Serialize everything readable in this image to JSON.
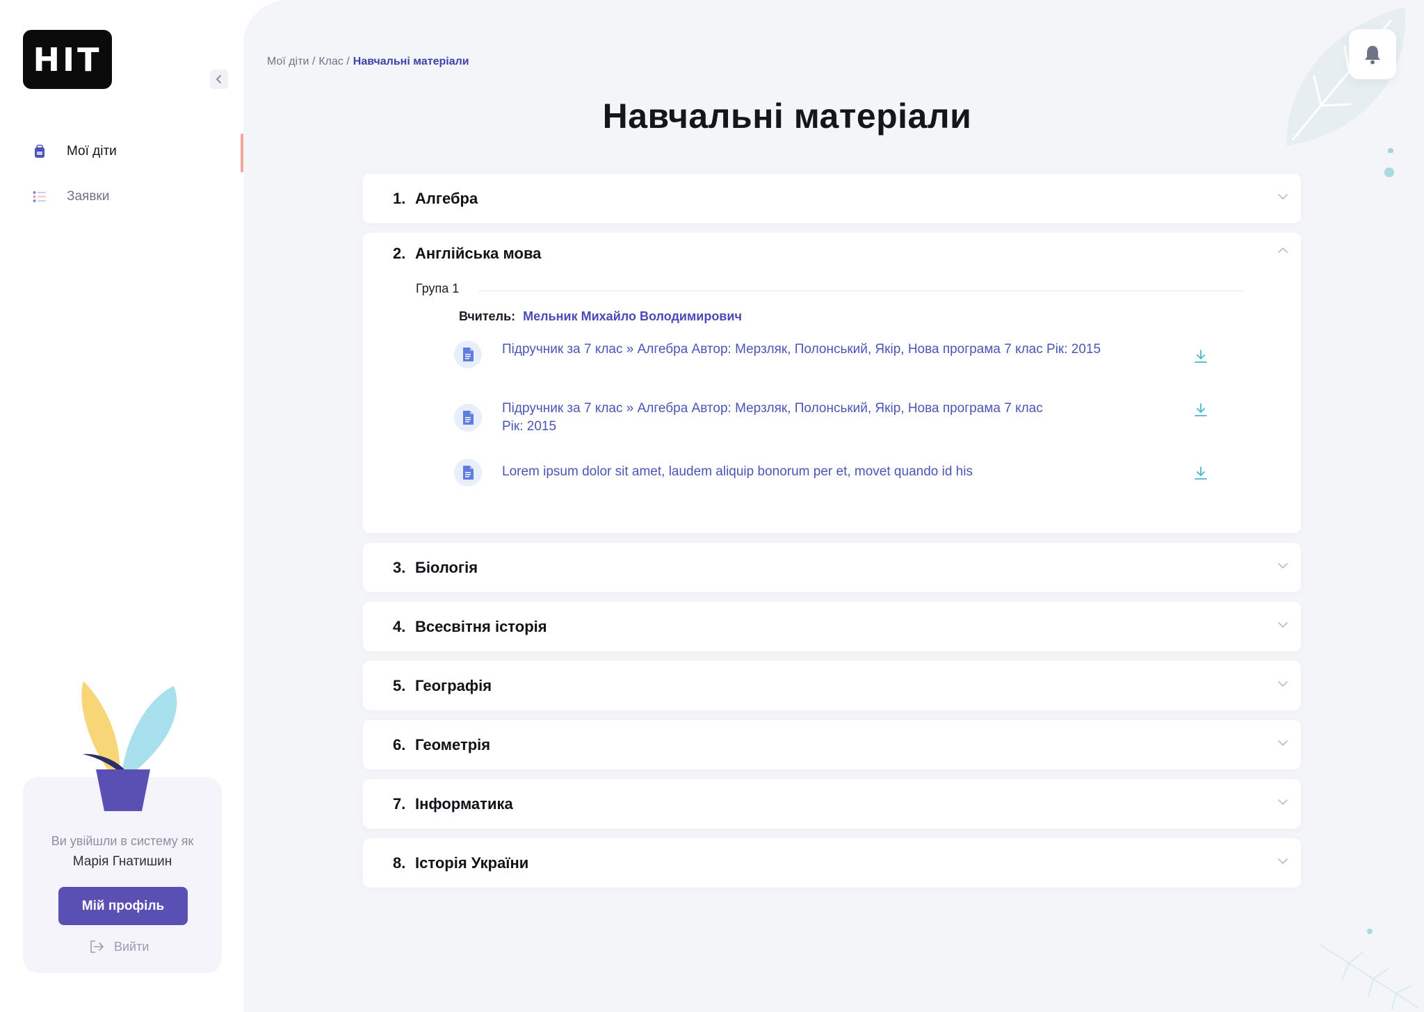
{
  "logo_text": "НІТ",
  "sidebar": {
    "items": [
      {
        "label": "Мої діти",
        "icon": "backpack-icon",
        "active": true
      },
      {
        "label": "Заявки",
        "icon": "list-icon",
        "active": false
      }
    ],
    "logged_in_as": "Ви увійшли в систему як",
    "user_name": "Марія Гнатишин",
    "profile_button": "Мій профіль",
    "logout": "Вийти"
  },
  "breadcrumb": [
    {
      "label": "Мої діти /"
    },
    {
      "label": "Клас /"
    },
    {
      "label": "Навчальні матеріали"
    }
  ],
  "page_title": "Навчальні матеріали",
  "subjects": [
    {
      "num": "1.",
      "name": "Алгебра",
      "open": false
    },
    {
      "num": "2.",
      "name": "Англійська мова",
      "open": true,
      "group": "Група 1",
      "teacher_label": "Вчитель:",
      "teacher_name": "Мельник Михайло Володимирович",
      "materials": [
        {
          "title": "Підручник за 7 клас » Алгебра Автор: Мерзляк, Полонський, Якір, Нова програма 7 клас Рік: 2015"
        },
        {
          "title": "Підручник за 7 клас » Алгебра Автор: Мерзляк, Полонський, Якір, Нова програма 7 клас Рік: 2015"
        },
        {
          "title": "Lorem ipsum dolor sit amet, laudem aliquip bonorum per et, movet quando id his"
        }
      ]
    },
    {
      "num": "3.",
      "name": "Біологія",
      "open": false
    },
    {
      "num": "4.",
      "name": "Всесвітня історія",
      "open": false
    },
    {
      "num": "5.",
      "name": "Географія",
      "open": false
    },
    {
      "num": "6.",
      "name": "Геометрія",
      "open": false
    },
    {
      "num": "7.",
      "name": "Інформатика",
      "open": false
    },
    {
      "num": "8.",
      "name": "Історія України",
      "open": false
    }
  ],
  "colors": {
    "accent": "#5a50b3",
    "link": "#4b55b6",
    "download": "#4cb8c4",
    "background": "#f4f5f9"
  }
}
